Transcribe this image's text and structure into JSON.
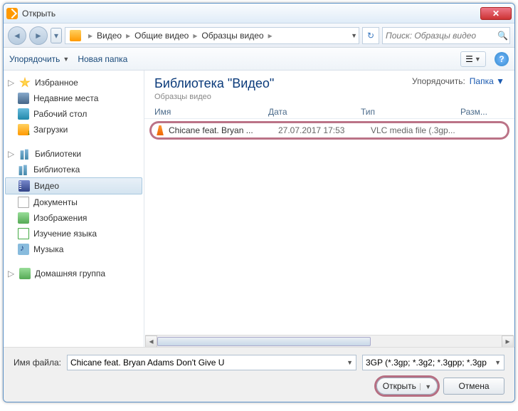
{
  "window": {
    "title": "Открыть"
  },
  "breadcrumb": {
    "items": [
      "Видео",
      "Общие видео",
      "Образцы видео"
    ]
  },
  "search": {
    "placeholder": "Поиск: Образцы видео"
  },
  "toolbar": {
    "organize": "Упорядочить",
    "new_folder": "Новая папка"
  },
  "sidebar": {
    "favorites": {
      "label": "Избранное",
      "items": [
        "Недавние места",
        "Рабочий стол",
        "Загрузки"
      ]
    },
    "libraries": {
      "label": "Библиотеки",
      "items": [
        "Библиотека",
        "Видео",
        "Документы",
        "Изображения",
        "Изучение языка",
        "Музыка"
      ]
    },
    "homegroup": {
      "label": "Домашняя группа"
    }
  },
  "library": {
    "title": "Библиотека \"Видео\"",
    "subtitle": "Образцы видео",
    "sort_label": "Упорядочить:",
    "sort_value": "Папка"
  },
  "columns": {
    "name": "Имя",
    "date": "Дата",
    "type": "Тип",
    "size": "Разм..."
  },
  "files": [
    {
      "name": "Chicane feat. Bryan ...",
      "date": "27.07.2017 17:53",
      "type": "VLC media file (.3gp..."
    }
  ],
  "footer": {
    "filename_label": "Имя файла:",
    "filename_value": "Chicane feat. Bryan Adams Don't Give U",
    "filter": "3GP (*.3gp; *.3g2; *.3gpp; *.3gp",
    "open": "Открыть",
    "cancel": "Отмена"
  }
}
